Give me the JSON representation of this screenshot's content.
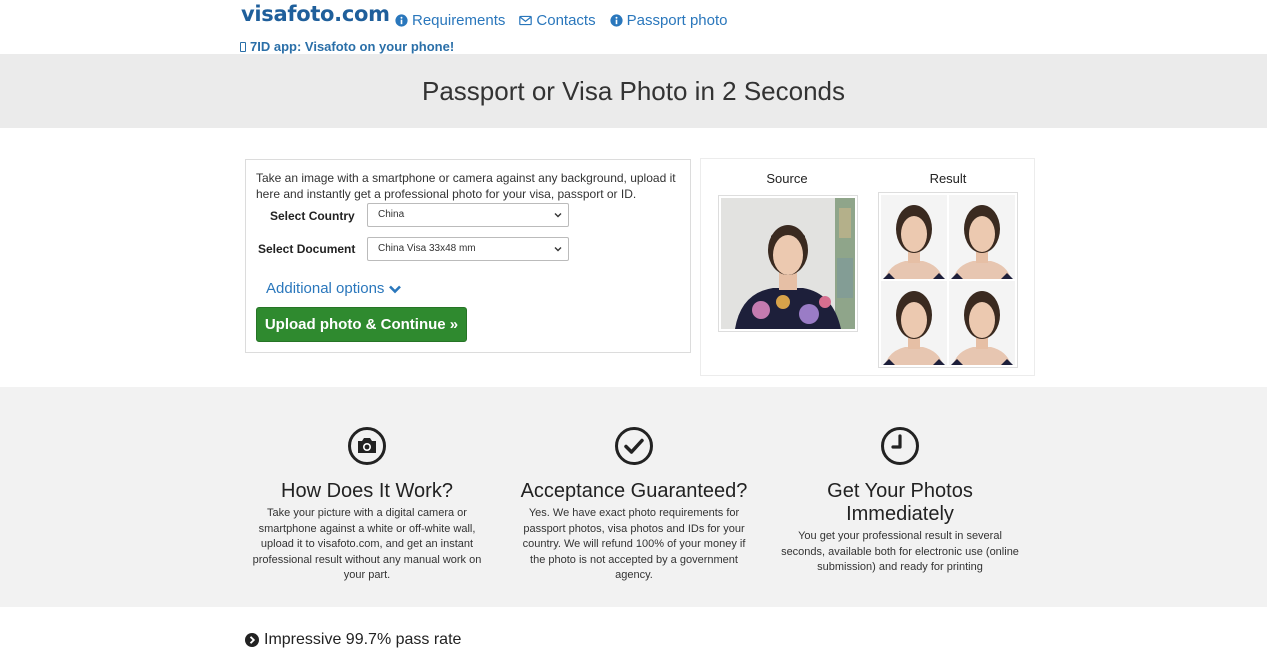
{
  "header": {
    "logo": "visafoto.com",
    "nav": [
      {
        "label": "Requirements",
        "icon": "info-circle-icon"
      },
      {
        "label": "Contacts",
        "icon": "envelope-icon"
      },
      {
        "label": "Passport photo",
        "icon": "info-circle-icon"
      }
    ],
    "app_link": "7ID app: Visafoto on your phone!"
  },
  "banner": {
    "title": "Passport or Visa Photo in 2 Seconds"
  },
  "form": {
    "intro": "Take an image with a smartphone or camera against any background, upload it here and instantly get a professional photo for your visa, passport or ID.",
    "country_label": "Select Country",
    "country_value": "China",
    "document_label": "Select Document",
    "document_value": "China Visa 33x48 mm",
    "additional_options": "Additional options",
    "upload_button": "Upload photo & Continue »"
  },
  "sample": {
    "source_title": "Source",
    "result_title": "Result"
  },
  "features": [
    {
      "icon": "camera-icon",
      "title": "How Does It Work?",
      "text": "Take your picture with a digital camera or smartphone against a white or off-white wall, upload it to visafoto.com, and get an instant professional result without any manual work on your part."
    },
    {
      "icon": "check-circle-icon",
      "title": "Acceptance Guaranteed?",
      "text": "Yes. We have exact photo requirements for passport photos, visa photos and IDs for your country. We will refund 100% of your money if the photo is not accepted by a government agency."
    },
    {
      "icon": "clock-icon",
      "title": "Get Your Photos Immediately",
      "text": "You get your professional result in several seconds, available both for electronic use (online submission) and ready for printing"
    }
  ],
  "pass_rate": "Impressive 99.7% pass rate",
  "colors": {
    "brand": "#1f5f9b",
    "link": "#2a77bc",
    "button": "#2f8a2f",
    "banner_bg": "#ebebeb",
    "features_bg": "#f2f2f2"
  }
}
